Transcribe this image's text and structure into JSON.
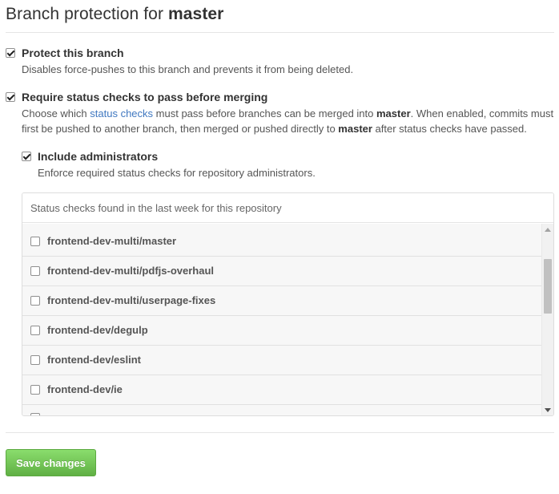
{
  "header": {
    "title_prefix": "Branch protection for",
    "branch_name": "master"
  },
  "protect": {
    "label": "Protect this branch",
    "checked": true,
    "description": "Disables force-pushes to this branch and prevents it from being deleted."
  },
  "status_checks": {
    "label": "Require status checks to pass before merging",
    "checked": true,
    "desc_part1": "Choose which ",
    "desc_link": "status checks",
    "desc_part2": " must pass before branches can be merged into ",
    "desc_branch1": "master",
    "desc_part3": ". When enabled, commits must first be pushed to another branch, then merged or pushed directly to ",
    "desc_branch2": "master",
    "desc_part4": " after status checks have passed."
  },
  "admins": {
    "label": "Include administrators",
    "checked": true,
    "description": "Enforce required status checks for repository administrators."
  },
  "checks_box": {
    "header": "Status checks found in the last week for this repository",
    "items": [
      {
        "label": "frontend-dev-multi/master",
        "checked": false
      },
      {
        "label": "frontend-dev-multi/pdfjs-overhaul",
        "checked": false
      },
      {
        "label": "frontend-dev-multi/userpage-fixes",
        "checked": false
      },
      {
        "label": "frontend-dev/degulp",
        "checked": false
      },
      {
        "label": "frontend-dev/eslint",
        "checked": false
      },
      {
        "label": "frontend-dev/ie",
        "checked": false
      }
    ]
  },
  "save_button": {
    "label": "Save changes",
    "color": "#60b044"
  },
  "colors": {
    "link": "#4078c0"
  }
}
